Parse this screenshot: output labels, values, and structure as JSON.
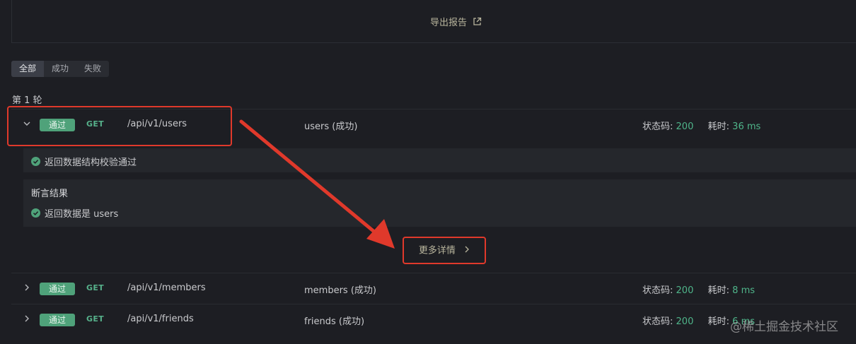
{
  "export": {
    "label": "导出报告",
    "icon": "external-link-icon"
  },
  "filters": [
    {
      "label": "全部",
      "active": true
    },
    {
      "label": "成功",
      "active": false
    },
    {
      "label": "失败",
      "active": false
    }
  ],
  "round_label": "第 1 轮",
  "requests": [
    {
      "expanded": true,
      "badge": "通过",
      "method": "GET",
      "path": "/api/v1/users",
      "name": "users (成功)",
      "status_label": "状态码:",
      "status_code": "200",
      "time_label": "耗时:",
      "time_value": "36 ms"
    },
    {
      "expanded": false,
      "badge": "通过",
      "method": "GET",
      "path": "/api/v1/members",
      "name": "members (成功)",
      "status_label": "状态码:",
      "status_code": "200",
      "time_label": "耗时:",
      "time_value": "8 ms"
    },
    {
      "expanded": false,
      "badge": "通过",
      "method": "GET",
      "path": "/api/v1/friends",
      "name": "friends (成功)",
      "status_label": "状态码:",
      "status_code": "200",
      "time_label": "耗时:",
      "time_value": "6 ms"
    }
  ],
  "details": {
    "schema_check": "返回数据结构校验通过",
    "assert_title": "断言结果",
    "assert_item": "返回数据是 users",
    "more_button": "更多详情"
  },
  "colors": {
    "accent_gold": "#b9b59d",
    "pass_green": "#4fa27a",
    "annotation_red": "#e0392b"
  },
  "watermark": "@稀土掘金技术社区"
}
